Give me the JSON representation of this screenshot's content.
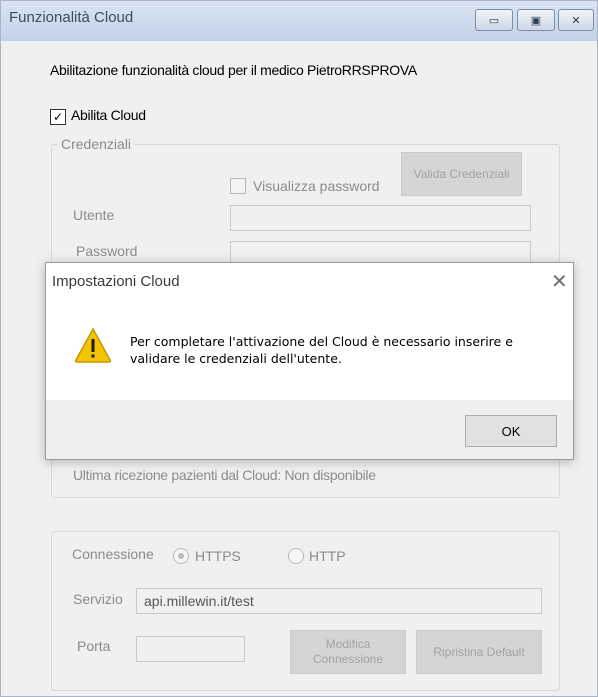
{
  "window": {
    "title": "Funzionalità Cloud",
    "minimize_glyph": "▭",
    "maximize_glyph": "▣",
    "close_glyph": "✕"
  },
  "header": {
    "description": "Abilitazione funzionalità cloud per il medico  PietroRRSPROVA"
  },
  "abilita_cloud": {
    "label": "Abilita Cloud",
    "checked": true,
    "check_glyph": "✓"
  },
  "credenziali": {
    "legend": "Credenziali",
    "show_password_label": "Visualizza password",
    "validate_button": "Valida Credenziali",
    "user_label": "Utente",
    "user_value": "",
    "password_label": "Password",
    "password_value": ""
  },
  "status": {
    "last_receive": "Ultima ricezione pazienti dal Cloud: Non disponibile"
  },
  "connection": {
    "label": "Connessione",
    "https_label": "HTTPS",
    "http_label": "HTTP",
    "selected": "HTTPS",
    "service_label": "Servizio",
    "service_value": "api.millewin.it/test",
    "port_label": "Porta",
    "port_value": "",
    "modify_button": "Modifica Connessione",
    "restore_button": "Ripristina Default"
  },
  "dialog": {
    "title": "Impostazioni Cloud",
    "close_glyph": "✕",
    "icon": "warning-icon",
    "message": "Per completare l'attivazione del Cloud è necessario inserire e validare le credenziali dell'utente.",
    "ok_button": "OK"
  },
  "colors": {
    "warning_fill": "#f5c400",
    "warning_stroke": "#c89700",
    "disabled_text": "#8b8b8b",
    "window_bg": "#f0f0f0"
  }
}
